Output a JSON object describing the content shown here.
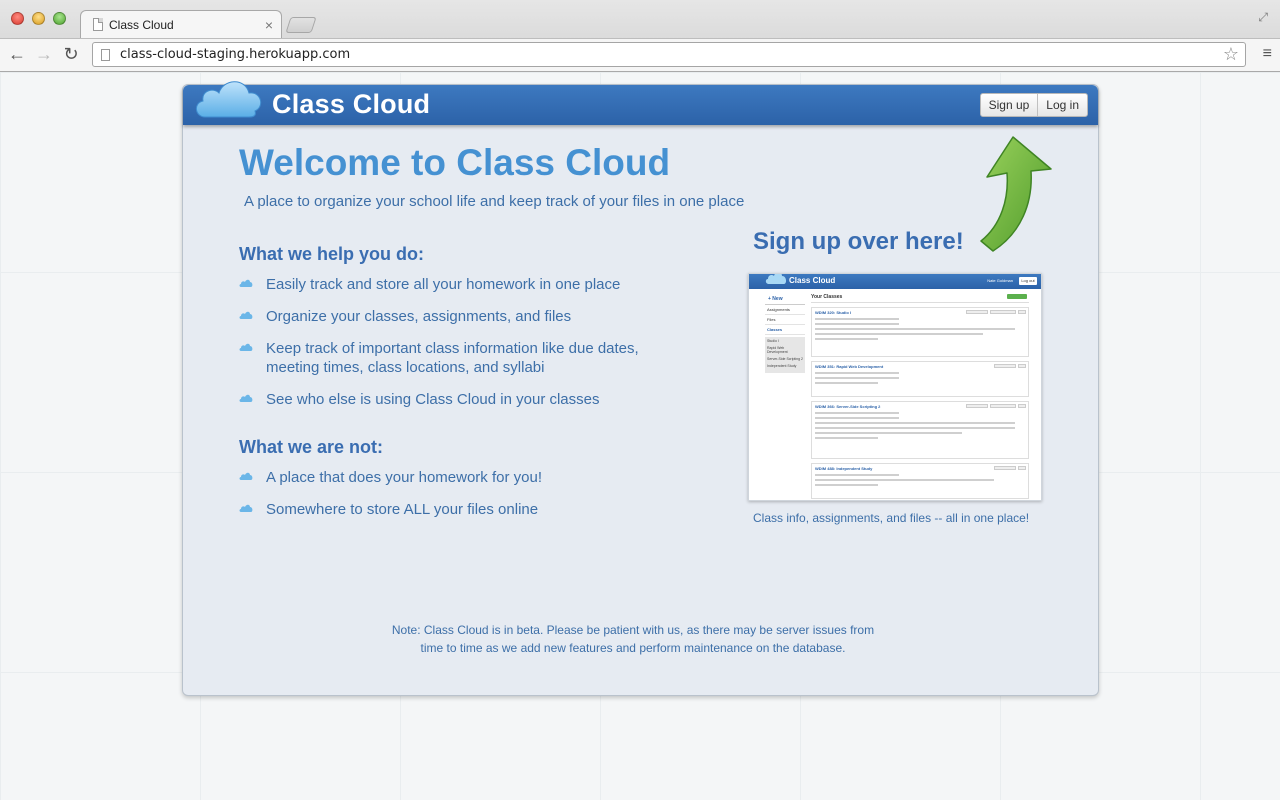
{
  "browser": {
    "tab_title": "Class Cloud",
    "tab_close": "×",
    "url": "class-cloud-staging.herokuapp.com"
  },
  "header": {
    "brand": "Class Cloud",
    "signup_label": "Sign up",
    "login_label": "Log in"
  },
  "hero": {
    "title": "Welcome to Class Cloud",
    "tagline": "A place to organize your school life and keep track of your files in one place"
  },
  "help": {
    "title": "What we help you do:",
    "items": [
      "Easily track and store all your homework in one place",
      "Organize your classes, assignments, and files",
      "Keep track of important class information like due dates, meeting times, class locations, and syllabi",
      "See who else is using Class Cloud in your classes"
    ]
  },
  "not": {
    "title": "What we are not:",
    "items": [
      "A place that does your homework for you!",
      "Somewhere to store ALL your files online"
    ]
  },
  "cta": {
    "signup_text": "Sign up over here!",
    "caption": "Class info, assignments, and files -- all in one place!"
  },
  "preview": {
    "brand": "Class Cloud",
    "user": "Nate Goldman",
    "logout": "Log out",
    "new": "+ New",
    "your_classes": "Your Classes",
    "nav": [
      "Assignments",
      "Files",
      "Classes"
    ],
    "sub": [
      "Studio I",
      "Rapid Web Development",
      "Server-Side Scripting 2",
      "Independent Study"
    ],
    "classes": [
      "WDIM 320: Studio I",
      "WDIM 351: Rapid Web Development",
      "WDIM 366: Server-Side Scripting 2",
      "WDIM 488: Independent Study"
    ]
  },
  "footer": {
    "note_line1": "Note: Class Cloud is in beta. Please be patient with us, as there may be server issues from",
    "note_line2": "time to time as we add new features and perform maintenance on the database."
  },
  "colors": {
    "accent": "#4591d2",
    "header_blue": "#2c62a8",
    "text_blue": "#3d6fa8",
    "arrow_green": "#6fb13a"
  }
}
